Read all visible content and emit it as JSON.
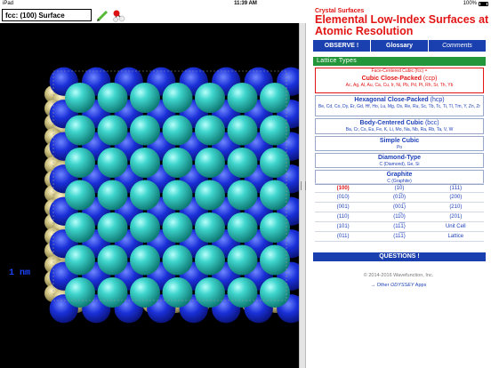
{
  "status": {
    "device": "iPad",
    "time": "11:39 AM",
    "battery": "100%"
  },
  "toolbar": {
    "surface_value": "fcc: (100) Surface",
    "pencil_icon": "pencil-icon",
    "molecule_icon": "molecule-icon"
  },
  "viewer": {
    "scale_label": "1 nm",
    "colors": {
      "background": "#000000",
      "top_atom": "#27c7bf",
      "second_atom": "#1a2fd6",
      "side_atom": "#c8bd7c"
    }
  },
  "panel": {
    "subtitle": "Crystal Surfaces",
    "title": "Elemental Low-Index Surfaces at Atomic Resolution",
    "buttons": [
      "OBSERVE !",
      "Glossary",
      "Comments"
    ],
    "lattice_header": "Lattice Types",
    "lattices": [
      {
        "top": "Face-Centered Cubic (fcc) =",
        "name": "Cubic Close-Packed",
        "abbr": "(ccp)",
        "elements": "Ac, Ag, Al, Au, Ca, Cu, Ir, Ni, Pb, Pd, Pt, Rh, Sr, Th, Yb",
        "selected": true
      },
      {
        "name": "Hexagonal Close-Packed",
        "abbr": "(hcp)",
        "elements": "Be, Cd, Co, Dy, Er, Gd, Hf, Ho, Lu, Mg, Os, Re, Ru, Sc, Tb, Tc, Ti, Tl, Tm, Y, Zn, Zr"
      },
      {
        "name": "Body-Centered Cubic",
        "abbr": "(bcc)",
        "elements": "Ba, Cr, Cs, Eu, Fe, K, Li, Mo, Na, Nb, Ra, Rb, Ta, V, W"
      },
      {
        "name": "Simple Cubic",
        "abbr": "",
        "elements": "Po"
      },
      {
        "name": "Diamond-Type",
        "abbr": "",
        "elements": "C (Diamond), Ge, Si"
      },
      {
        "name": "Graphite",
        "abbr": "",
        "elements": "C (Graphite)"
      }
    ],
    "miller_rows": [
      [
        "(100)",
        "(1̅0)",
        "(1̅11)"
      ],
      [
        "(010)",
        "(01̅0)",
        "(200)"
      ],
      [
        "(001)",
        "(001̅)",
        "(210)"
      ],
      [
        "(110)",
        "(11̅0)",
        "(201)"
      ],
      [
        "(101)",
        "(11̅1̅)",
        "Unit Cell"
      ],
      [
        "(011)",
        "(11̅1̅)",
        "Lattice"
      ]
    ],
    "questions_label": "QUESTIONS !",
    "copyright": "© 2014-2016  Wavefunction, Inc.",
    "other_prefix": "→ Other ",
    "other_brand": "ODYSSEY",
    "other_suffix": " Apps"
  }
}
